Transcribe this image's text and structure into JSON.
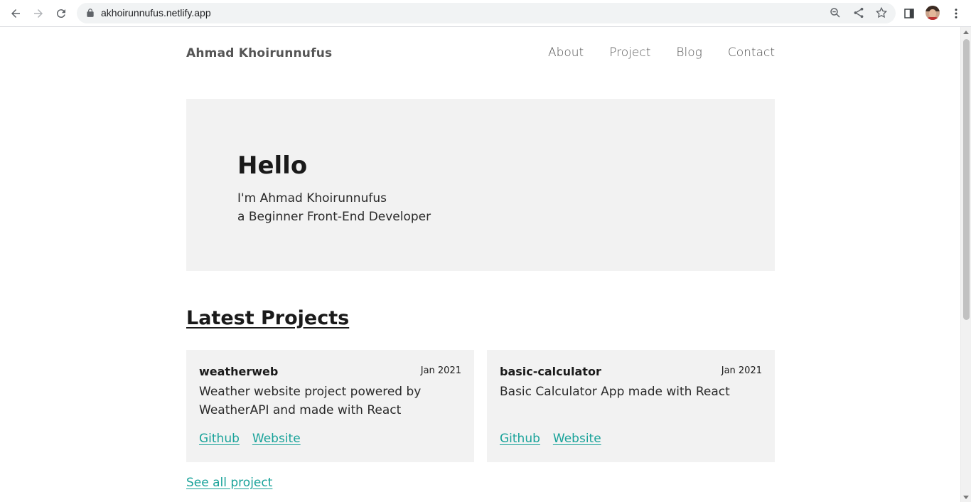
{
  "browser": {
    "url": "akhoirunnufus.netlify.app"
  },
  "site": {
    "brand": "Ahmad Khoirunnufus",
    "nav": [
      "About",
      "Project",
      "Blog",
      "Contact"
    ]
  },
  "hero": {
    "title": "Hello",
    "line1": "I'm Ahmad Khoirunnufus",
    "line2": "a Beginner Front-End Developer"
  },
  "projects": {
    "title": "Latest Projects",
    "items": [
      {
        "name": "weatherweb",
        "date": "Jan 2021",
        "description": "Weather website project powered by WeatherAPI and made with React",
        "github_label": "Github",
        "website_label": "Website"
      },
      {
        "name": "basic-calculator",
        "date": "Jan 2021",
        "description": "Basic Calculator App made with React",
        "github_label": "Github",
        "website_label": "Website"
      }
    ],
    "see_all": "See all project"
  },
  "colors": {
    "link": "#1aa39a",
    "card_bg": "#f2f2f2"
  }
}
